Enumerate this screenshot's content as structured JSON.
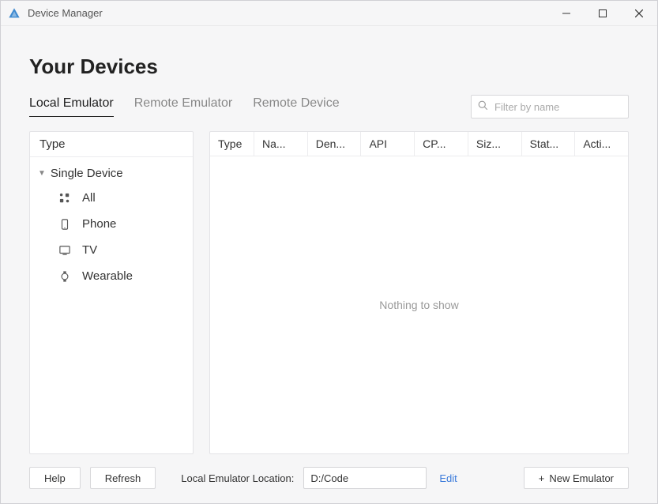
{
  "window": {
    "title": "Device Manager"
  },
  "page": {
    "title": "Your Devices"
  },
  "tabs": {
    "items": [
      {
        "label": "Local Emulator",
        "active": true
      },
      {
        "label": "Remote Emulator",
        "active": false
      },
      {
        "label": "Remote Device",
        "active": false
      }
    ]
  },
  "search": {
    "placeholder": "Filter by name",
    "value": ""
  },
  "sidebar": {
    "header": "Type",
    "group": {
      "label": "Single Device",
      "expanded": true,
      "items": [
        {
          "label": "All",
          "icon": "grid-icon"
        },
        {
          "label": "Phone",
          "icon": "phone-icon"
        },
        {
          "label": "TV",
          "icon": "tv-icon"
        },
        {
          "label": "Wearable",
          "icon": "watch-icon"
        }
      ]
    }
  },
  "table": {
    "columns": [
      "Type",
      "Na...",
      "Den...",
      "API",
      "CP...",
      "Siz...",
      "Stat...",
      "Acti..."
    ],
    "empty_text": "Nothing to show"
  },
  "footer": {
    "help_label": "Help",
    "refresh_label": "Refresh",
    "location_label": "Local Emulator Location:",
    "location_value": "D:/Code",
    "edit_label": "Edit",
    "new_emulator_label": "New Emulator"
  }
}
